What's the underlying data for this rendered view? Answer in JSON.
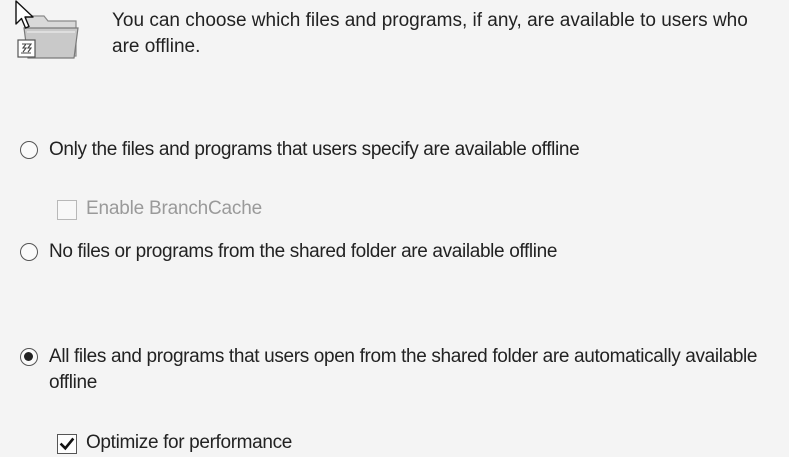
{
  "header": {
    "icon": "offline-folder-icon",
    "description": "You can choose which files and programs, if any, are available to users who are offline."
  },
  "options": [
    {
      "label": "Only the files and programs that users specify are available offline",
      "selected": false,
      "sub_checkbox": {
        "label": "Enable BranchCache",
        "checked": false,
        "enabled": false
      }
    },
    {
      "label": "No files or programs from the shared folder are available offline",
      "selected": false
    },
    {
      "label": "All files and programs that users open from the shared folder are automatically available offline",
      "selected": true,
      "sub_checkbox": {
        "label": "Optimize for performance",
        "checked": true,
        "enabled": true
      }
    }
  ],
  "cursor": "arrow-cursor-icon"
}
